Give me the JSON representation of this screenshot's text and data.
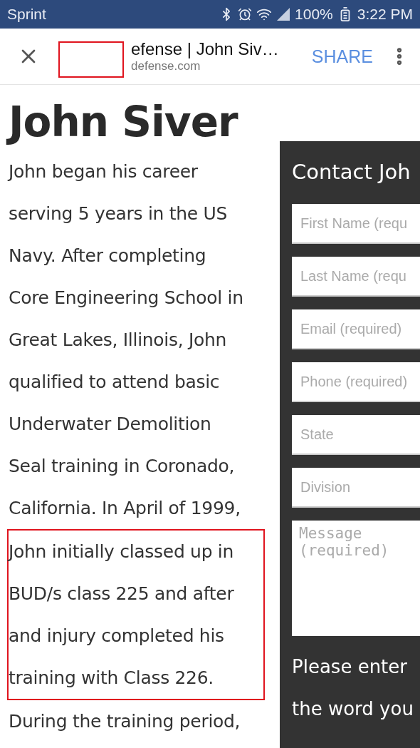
{
  "status_bar": {
    "carrier": "Sprint",
    "battery": "100%",
    "time": "3:22 PM"
  },
  "toolbar": {
    "title": "efense | John Siv…",
    "url": "defense.com",
    "share": "SHARE",
    "redacted": true
  },
  "article": {
    "heading": "John Siver",
    "lines": [
      {
        "text": "John began his career",
        "highlighted": false
      },
      {
        "text": "serving 5 years in the US",
        "highlighted": false
      },
      {
        "text": "Navy. After completing",
        "highlighted": false
      },
      {
        "text": "Core Engineering School in",
        "highlighted": false
      },
      {
        "text": "Great Lakes, Illinois, John",
        "highlighted": false
      },
      {
        "text": "qualified to attend basic",
        "highlighted": false
      },
      {
        "text": "Underwater Demolition",
        "highlighted": false
      },
      {
        "text": "Seal training in Coronado,",
        "highlighted": false
      },
      {
        "text": "California. In April of 1999,",
        "highlighted": false
      },
      {
        "text": "John initially classed up in",
        "highlighted": true
      },
      {
        "text": "BUD/s class 225 and after",
        "highlighted": true
      },
      {
        "text": "and injury completed his",
        "highlighted": true
      },
      {
        "text": "training with Class 226.",
        "highlighted": true
      },
      {
        "text": "During the training period,",
        "highlighted": false
      }
    ]
  },
  "contact_form": {
    "title": "Contact Joh",
    "fields": [
      {
        "placeholder": "First Name (requ",
        "kind": "input"
      },
      {
        "placeholder": "Last Name (requ",
        "kind": "input"
      },
      {
        "placeholder": "Email (required)",
        "kind": "input"
      },
      {
        "placeholder": "Phone (required)",
        "kind": "input"
      },
      {
        "placeholder": "State",
        "kind": "input"
      },
      {
        "placeholder": "Division",
        "kind": "input"
      },
      {
        "placeholder": "Message (required)",
        "kind": "textarea"
      }
    ],
    "captcha_lines": [
      "Please enter",
      "the word you"
    ]
  }
}
